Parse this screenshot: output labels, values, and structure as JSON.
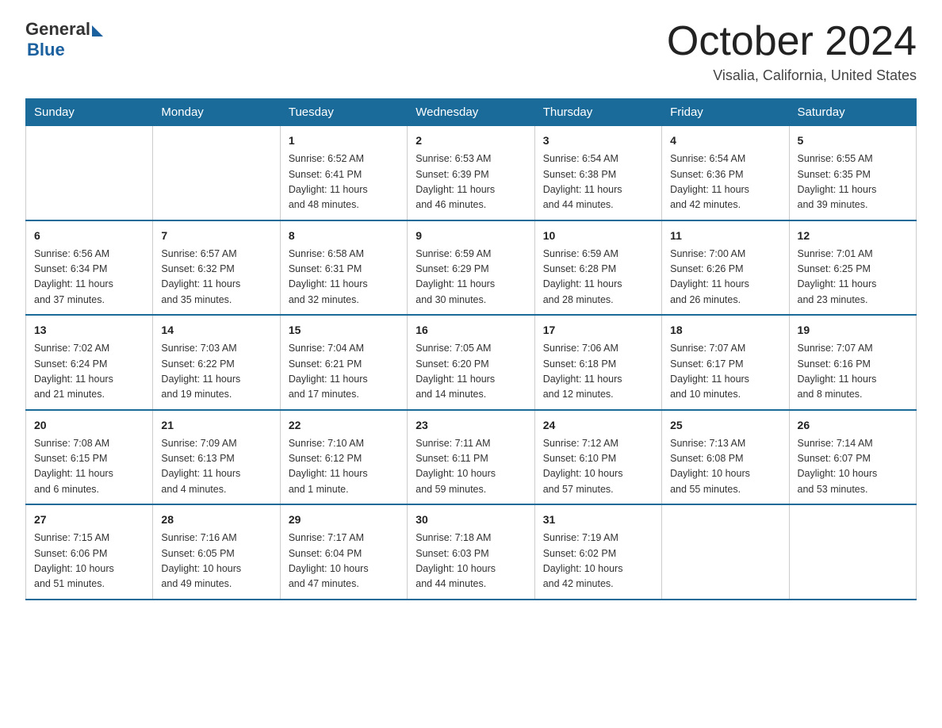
{
  "header": {
    "logo_general": "General",
    "logo_blue": "Blue",
    "title": "October 2024",
    "location": "Visalia, California, United States"
  },
  "weekdays": [
    "Sunday",
    "Monday",
    "Tuesday",
    "Wednesday",
    "Thursday",
    "Friday",
    "Saturday"
  ],
  "weeks": [
    [
      {
        "day": "",
        "info": ""
      },
      {
        "day": "",
        "info": ""
      },
      {
        "day": "1",
        "info": "Sunrise: 6:52 AM\nSunset: 6:41 PM\nDaylight: 11 hours\nand 48 minutes."
      },
      {
        "day": "2",
        "info": "Sunrise: 6:53 AM\nSunset: 6:39 PM\nDaylight: 11 hours\nand 46 minutes."
      },
      {
        "day": "3",
        "info": "Sunrise: 6:54 AM\nSunset: 6:38 PM\nDaylight: 11 hours\nand 44 minutes."
      },
      {
        "day": "4",
        "info": "Sunrise: 6:54 AM\nSunset: 6:36 PM\nDaylight: 11 hours\nand 42 minutes."
      },
      {
        "day": "5",
        "info": "Sunrise: 6:55 AM\nSunset: 6:35 PM\nDaylight: 11 hours\nand 39 minutes."
      }
    ],
    [
      {
        "day": "6",
        "info": "Sunrise: 6:56 AM\nSunset: 6:34 PM\nDaylight: 11 hours\nand 37 minutes."
      },
      {
        "day": "7",
        "info": "Sunrise: 6:57 AM\nSunset: 6:32 PM\nDaylight: 11 hours\nand 35 minutes."
      },
      {
        "day": "8",
        "info": "Sunrise: 6:58 AM\nSunset: 6:31 PM\nDaylight: 11 hours\nand 32 minutes."
      },
      {
        "day": "9",
        "info": "Sunrise: 6:59 AM\nSunset: 6:29 PM\nDaylight: 11 hours\nand 30 minutes."
      },
      {
        "day": "10",
        "info": "Sunrise: 6:59 AM\nSunset: 6:28 PM\nDaylight: 11 hours\nand 28 minutes."
      },
      {
        "day": "11",
        "info": "Sunrise: 7:00 AM\nSunset: 6:26 PM\nDaylight: 11 hours\nand 26 minutes."
      },
      {
        "day": "12",
        "info": "Sunrise: 7:01 AM\nSunset: 6:25 PM\nDaylight: 11 hours\nand 23 minutes."
      }
    ],
    [
      {
        "day": "13",
        "info": "Sunrise: 7:02 AM\nSunset: 6:24 PM\nDaylight: 11 hours\nand 21 minutes."
      },
      {
        "day": "14",
        "info": "Sunrise: 7:03 AM\nSunset: 6:22 PM\nDaylight: 11 hours\nand 19 minutes."
      },
      {
        "day": "15",
        "info": "Sunrise: 7:04 AM\nSunset: 6:21 PM\nDaylight: 11 hours\nand 17 minutes."
      },
      {
        "day": "16",
        "info": "Sunrise: 7:05 AM\nSunset: 6:20 PM\nDaylight: 11 hours\nand 14 minutes."
      },
      {
        "day": "17",
        "info": "Sunrise: 7:06 AM\nSunset: 6:18 PM\nDaylight: 11 hours\nand 12 minutes."
      },
      {
        "day": "18",
        "info": "Sunrise: 7:07 AM\nSunset: 6:17 PM\nDaylight: 11 hours\nand 10 minutes."
      },
      {
        "day": "19",
        "info": "Sunrise: 7:07 AM\nSunset: 6:16 PM\nDaylight: 11 hours\nand 8 minutes."
      }
    ],
    [
      {
        "day": "20",
        "info": "Sunrise: 7:08 AM\nSunset: 6:15 PM\nDaylight: 11 hours\nand 6 minutes."
      },
      {
        "day": "21",
        "info": "Sunrise: 7:09 AM\nSunset: 6:13 PM\nDaylight: 11 hours\nand 4 minutes."
      },
      {
        "day": "22",
        "info": "Sunrise: 7:10 AM\nSunset: 6:12 PM\nDaylight: 11 hours\nand 1 minute."
      },
      {
        "day": "23",
        "info": "Sunrise: 7:11 AM\nSunset: 6:11 PM\nDaylight: 10 hours\nand 59 minutes."
      },
      {
        "day": "24",
        "info": "Sunrise: 7:12 AM\nSunset: 6:10 PM\nDaylight: 10 hours\nand 57 minutes."
      },
      {
        "day": "25",
        "info": "Sunrise: 7:13 AM\nSunset: 6:08 PM\nDaylight: 10 hours\nand 55 minutes."
      },
      {
        "day": "26",
        "info": "Sunrise: 7:14 AM\nSunset: 6:07 PM\nDaylight: 10 hours\nand 53 minutes."
      }
    ],
    [
      {
        "day": "27",
        "info": "Sunrise: 7:15 AM\nSunset: 6:06 PM\nDaylight: 10 hours\nand 51 minutes."
      },
      {
        "day": "28",
        "info": "Sunrise: 7:16 AM\nSunset: 6:05 PM\nDaylight: 10 hours\nand 49 minutes."
      },
      {
        "day": "29",
        "info": "Sunrise: 7:17 AM\nSunset: 6:04 PM\nDaylight: 10 hours\nand 47 minutes."
      },
      {
        "day": "30",
        "info": "Sunrise: 7:18 AM\nSunset: 6:03 PM\nDaylight: 10 hours\nand 44 minutes."
      },
      {
        "day": "31",
        "info": "Sunrise: 7:19 AM\nSunset: 6:02 PM\nDaylight: 10 hours\nand 42 minutes."
      },
      {
        "day": "",
        "info": ""
      },
      {
        "day": "",
        "info": ""
      }
    ]
  ]
}
